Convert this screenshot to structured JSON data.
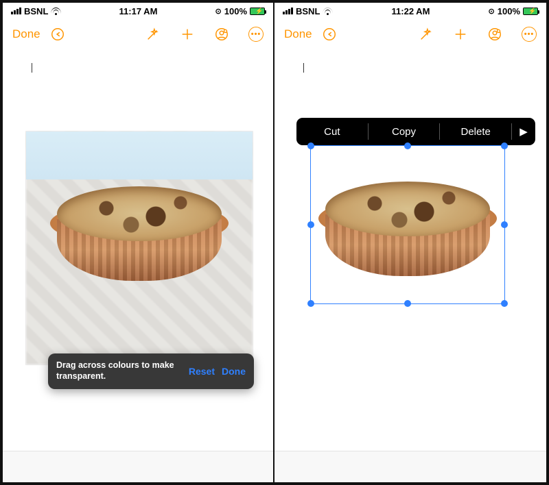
{
  "left": {
    "status": {
      "carrier": "BSNL",
      "time": "11:17 AM",
      "battery_pct": "100%"
    },
    "toolbar": {
      "done": "Done"
    },
    "alpha_bar": {
      "message": "Drag across colours to make transparent.",
      "reset": "Reset",
      "done": "Done"
    }
  },
  "right": {
    "status": {
      "carrier": "BSNL",
      "time": "11:22 AM",
      "battery_pct": "100%"
    },
    "toolbar": {
      "done": "Done"
    },
    "popover": {
      "cut": "Cut",
      "copy": "Copy",
      "delete": "Delete",
      "more": "▶"
    }
  }
}
